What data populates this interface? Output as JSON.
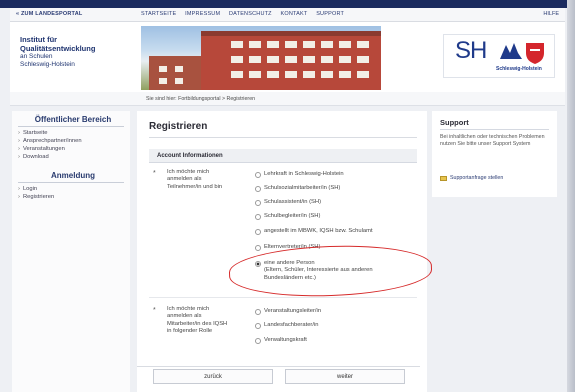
{
  "utility": {
    "back_link": "« ZUM LANDESPORTAL",
    "nav": [
      "STARTSEITE",
      "IMPRESSUM",
      "DATENSCHUTZ",
      "KONTAKT",
      "SUPPORT"
    ],
    "help": "HILFE"
  },
  "header": {
    "institute_line1": "Institut für",
    "institute_line2": "Qualitätsentwicklung",
    "institute_line3": "an Schulen",
    "institute_line4": "Schleswig-Holstein",
    "logo_text": "SH",
    "logo_sub": "Schleswig-Holstein"
  },
  "breadcrumb": "Sie sind hier: Fortbildungsportal > Registrieren",
  "sidebar": {
    "public_title": "Öffentlicher Bereich",
    "public_items": [
      "Startseite",
      "Ansprechpartner/innen",
      "Veranstaltungen",
      "Download"
    ],
    "login_title": "Anmeldung",
    "login_items": [
      "Login",
      "Registrieren"
    ]
  },
  "main": {
    "title": "Registrieren",
    "section": "Account Informationen",
    "q1_line1": "Ich möchte mich",
    "q1_line2": "anmelden als",
    "q1_line3": "Teilnehmer/in und bin",
    "q1_options": [
      "Lehrkraft in Schleswig-Holstein",
      "Schulsozialmitarbeiter/in (SH)",
      "Schulassistent/in (SH)",
      "Schulbegleiter/in (SH)",
      "angestellt im MBWK, IQSH bzw. Schulamt",
      "Elternvertreter/in (SH)"
    ],
    "q1_other_line1": "eine andere Person",
    "q1_other_line2": "(Eltern, Schüler, Interessierte aus anderen",
    "q1_other_line3": "Bundesländern etc.)",
    "q2_line1": "Ich möchte mich",
    "q2_line2": "anmelden als",
    "q2_line3": "Mitarbeiter/in des IQSH",
    "q2_line4": "in folgender Rolle",
    "q2_options": [
      "Veranstaltungsleiter/in",
      "Landesfachberater/in",
      "Verwaltungskraft"
    ],
    "back_button": "zurück",
    "next_button": "weiter"
  },
  "support": {
    "title": "Support",
    "text": "Bei inhaltlichen oder technischen Problemen nutzen Sie bitte unser Support System",
    "link": "Supportanfrage stellen"
  },
  "colors": {
    "navy": "#1a2a5e",
    "annotation_red": "#d62b2b"
  }
}
